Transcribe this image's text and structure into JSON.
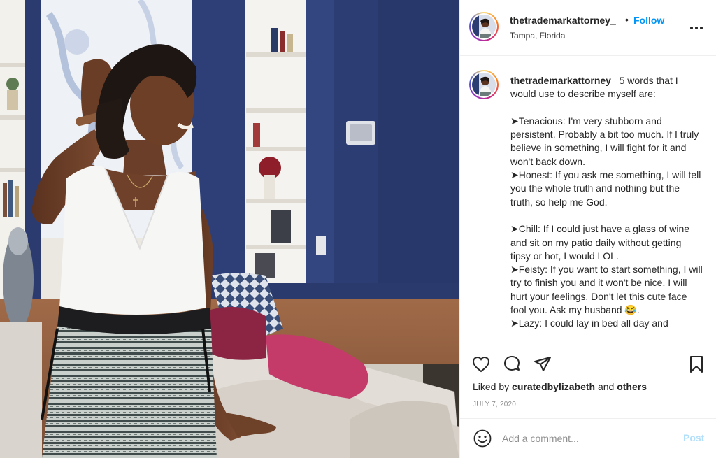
{
  "header": {
    "username": "thetrademarkattorney_",
    "dot": "•",
    "follow_label": "Follow",
    "location": "Tampa, Florida"
  },
  "caption": {
    "username": "thetrademarkattorney_",
    "text": " 5 words that I would use to describe myself are:\n\n➤Tenacious: I'm very stubborn and persistent. Probably a bit too much. If I truly believe in something, I will fight for it and won't back down.\n➤Honest: If you ask me something, I will tell you the whole truth and nothing but the truth, so help me God.\n\n➤Chill: If I could just have a glass of wine and sit on my patio daily without getting tipsy or hot, I would LOL.\n➤Feisty: If you want to start something, I will try to finish you and it won't be nice. I will hurt your feelings. Don't let this cute face fool you. Ask my husband 😂.\n➤Lazy: I could lay in bed all day and"
  },
  "likes": {
    "prefix": "Liked by ",
    "user": "curatedbylizabeth",
    "conjunction": " and ",
    "others": "others"
  },
  "date": "JULY 7, 2020",
  "comment": {
    "placeholder": "Add a comment...",
    "post_label": "Post"
  },
  "icons": {
    "more": "more-options-icon",
    "like": "heart-icon",
    "comment": "comment-icon",
    "share": "share-icon",
    "save": "bookmark-icon",
    "emoji": "emoji-icon"
  },
  "colors": {
    "link_blue": "#0095f6",
    "post_disabled": "#b2dffc",
    "muted": "#8e8e8e",
    "text": "#262626",
    "wall_navy": "#2c3d73"
  }
}
